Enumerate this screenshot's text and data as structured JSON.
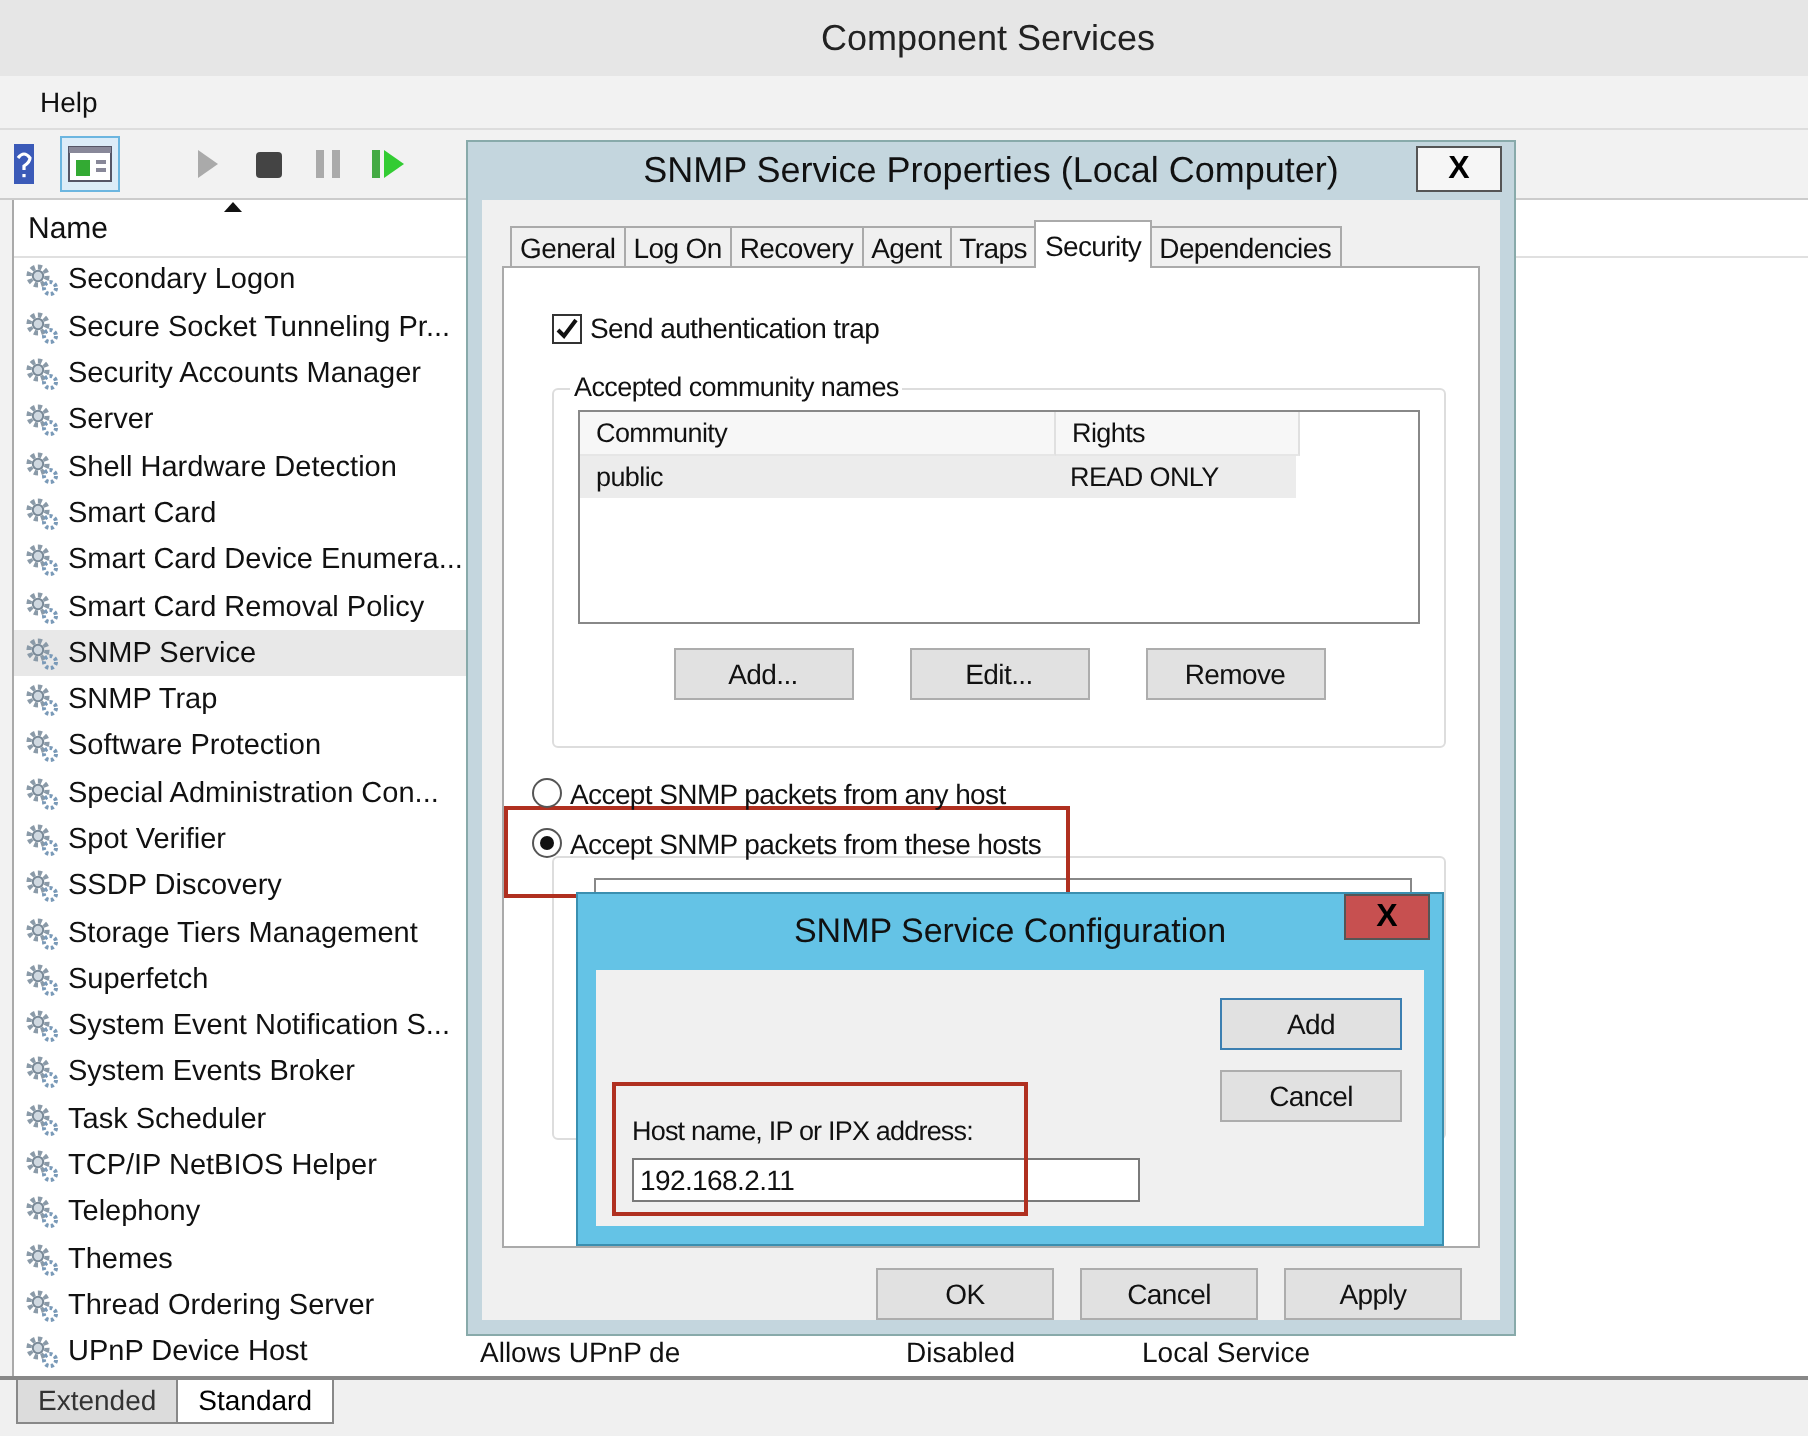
{
  "window": {
    "title": "Component Services"
  },
  "menu": [
    "Help"
  ],
  "toolbar": [
    {
      "kind": "help",
      "disabled": false,
      "pressed": false
    },
    {
      "kind": "console",
      "disabled": false,
      "pressed": true
    },
    {
      "kind": "play",
      "disabled": true,
      "pressed": false
    },
    {
      "kind": "stop",
      "disabled": false,
      "pressed": false
    },
    {
      "kind": "pause",
      "disabled": true,
      "pressed": false
    },
    {
      "kind": "resume",
      "disabled": false,
      "pressed": false
    }
  ],
  "services": {
    "column": "Name",
    "rows": [
      {
        "name": "Secondary Logon",
        "selected": false
      },
      {
        "name": "Secure Socket Tunneling Pr...",
        "selected": false
      },
      {
        "name": "Security Accounts Manager",
        "selected": false
      },
      {
        "name": "Server",
        "selected": false
      },
      {
        "name": "Shell Hardware Detection",
        "selected": false
      },
      {
        "name": "Smart Card",
        "selected": false
      },
      {
        "name": "Smart Card Device Enumera...",
        "selected": false
      },
      {
        "name": "Smart Card Removal Policy",
        "selected": false
      },
      {
        "name": "SNMP Service",
        "selected": true
      },
      {
        "name": "SNMP Trap",
        "selected": false
      },
      {
        "name": "Software Protection",
        "selected": false
      },
      {
        "name": "Special Administration Con...",
        "selected": false
      },
      {
        "name": "Spot Verifier",
        "selected": false
      },
      {
        "name": "SSDP Discovery",
        "selected": false
      },
      {
        "name": "Storage Tiers Management",
        "selected": false
      },
      {
        "name": "Superfetch",
        "selected": false
      },
      {
        "name": "System Event Notification S...",
        "selected": false
      },
      {
        "name": "System Events Broker",
        "selected": false
      },
      {
        "name": "Task Scheduler",
        "selected": false
      },
      {
        "name": "TCP/IP NetBIOS Helper",
        "selected": false
      },
      {
        "name": "Telephony",
        "selected": false
      },
      {
        "name": "Themes",
        "selected": false
      },
      {
        "name": "Thread Ordering Server",
        "selected": false
      },
      {
        "name": "UPnP Device Host",
        "selected": false,
        "description": "Allows UPnP de",
        "startup": "Disabled",
        "log_on_as": "Local Service"
      }
    ]
  },
  "view_tabs": [
    {
      "label": "Extended",
      "selected": false
    },
    {
      "label": "Standard",
      "selected": true
    }
  ],
  "properties_dialog": {
    "title": "SNMP Service Properties (Local Computer)",
    "close": "X",
    "tabs": [
      {
        "label": "General",
        "selected": false
      },
      {
        "label": "Log On",
        "selected": false
      },
      {
        "label": "Recovery",
        "selected": false
      },
      {
        "label": "Agent",
        "selected": false
      },
      {
        "label": "Traps",
        "selected": false
      },
      {
        "label": "Security",
        "selected": true
      },
      {
        "label": "Dependencies",
        "selected": false
      }
    ],
    "auth_trap": {
      "label": "Send authentication trap",
      "checked": true
    },
    "communities": {
      "title": "Accepted community names",
      "columns": [
        "Community",
        "Rights"
      ],
      "rows": [
        {
          "community": "public",
          "rights": "READ ONLY",
          "selected": true
        }
      ],
      "buttons": [
        "Add...",
        "Edit...",
        "Remove"
      ]
    },
    "hosts": [
      {
        "label": "Accept SNMP packets from any host",
        "selected": false
      },
      {
        "label": "Accept SNMP packets from these hosts",
        "selected": true
      }
    ],
    "buttons": [
      "OK",
      "Cancel",
      "Apply"
    ]
  },
  "config_dialog": {
    "title": "SNMP Service Configuration",
    "close": "X",
    "field_label": "Host name, IP or IPX address:",
    "value": "192.168.2.11",
    "buttons": [
      "Add",
      "Cancel"
    ]
  }
}
